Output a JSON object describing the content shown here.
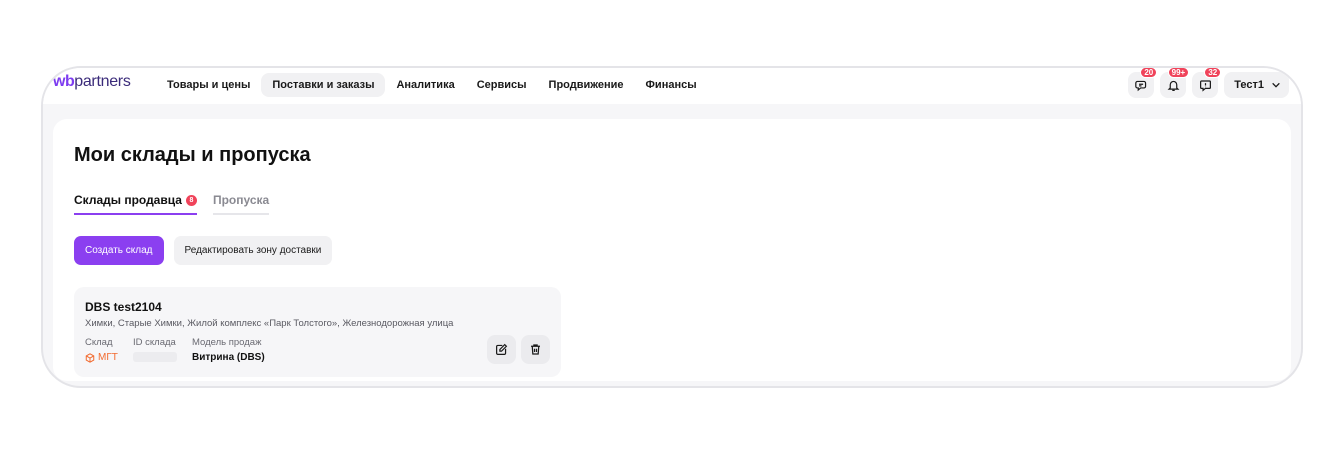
{
  "header": {
    "logo_wb": "wb",
    "logo_rest": "partners",
    "nav": [
      {
        "label": "Товары и цены",
        "active": false
      },
      {
        "label": "Поставки и заказы",
        "active": true
      },
      {
        "label": "Аналитика",
        "active": false
      },
      {
        "label": "Сервисы",
        "active": false
      },
      {
        "label": "Продвижение",
        "active": false
      },
      {
        "label": "Финансы",
        "active": false
      }
    ],
    "chat_badge": "20",
    "notifications_badge": "99+",
    "feedback_badge": "32",
    "user_name": "Тест1"
  },
  "page": {
    "title": "Мои склады и пропуска",
    "tabs": {
      "sellers_warehouses": "Склады продавца",
      "sellers_warehouses_count": "8",
      "passes": "Пропуска"
    },
    "buttons": {
      "create_warehouse": "Создать склад",
      "edit_delivery_zone": "Редактировать зону доставки"
    }
  },
  "warehouse": {
    "name": "DBS test2104",
    "address": "Химки, Старые Химки, Жилой комплекс «Парк Толстого», Железнодорожная улица",
    "label_warehouse": "Склад",
    "value_warehouse": "МГТ",
    "label_id": "ID склада",
    "label_model": "Модель продаж",
    "value_model": "Витрина (DBS)"
  },
  "colors": {
    "accent": "#8b3ff0",
    "badge": "#f0435a",
    "warehouse_tag": "#f26a2e"
  },
  "icons": [
    "chat-icon",
    "bell-icon",
    "feedback-icon",
    "chevron-down-icon",
    "box-icon",
    "edit-icon",
    "trash-icon"
  ]
}
